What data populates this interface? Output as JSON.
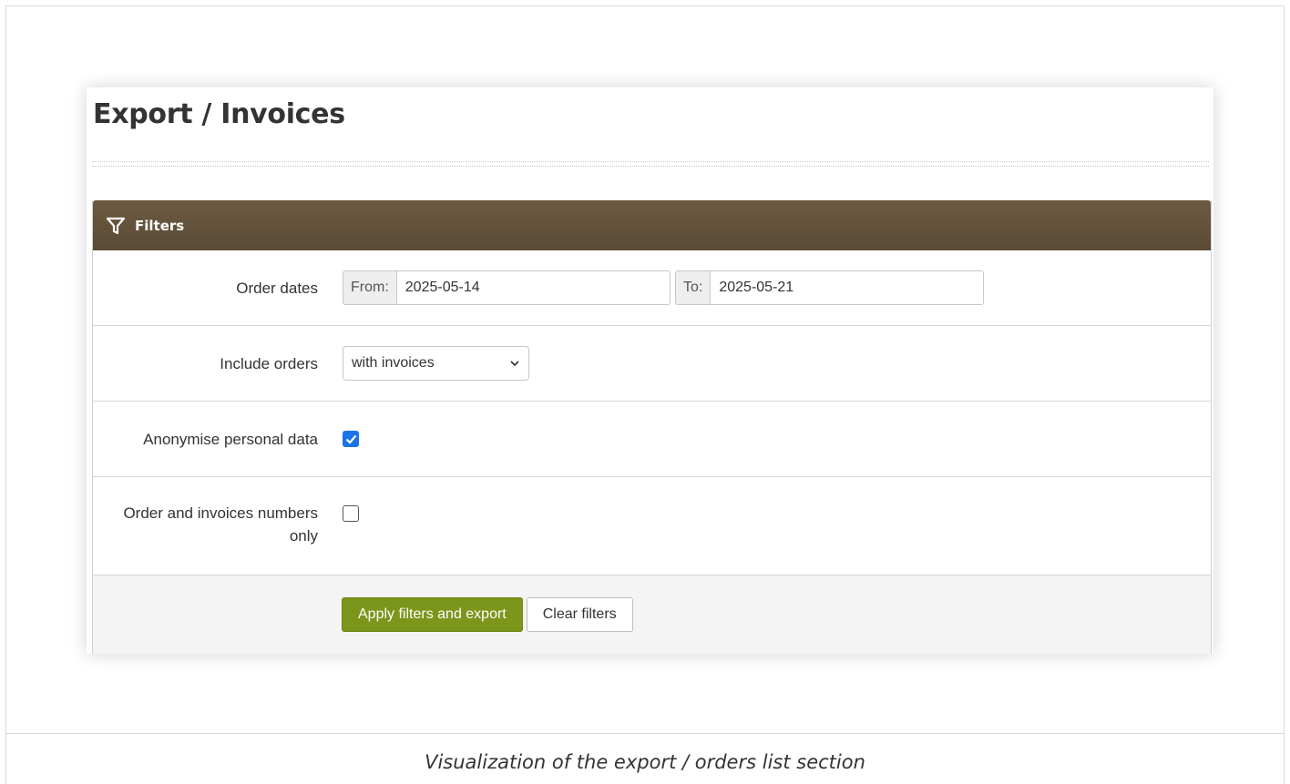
{
  "page": {
    "title": "Export / Invoices",
    "caption": "Visualization of the export / orders list section"
  },
  "filters": {
    "header": "Filters",
    "header_icon": "funnel-icon",
    "order_dates": {
      "label": "Order dates",
      "from_label": "From:",
      "from_value": "2025-05-14",
      "to_label": "To:",
      "to_value": "2025-05-21"
    },
    "include_orders": {
      "label": "Include orders",
      "selected": "with invoices"
    },
    "anonymise": {
      "label": "Anonymise personal data",
      "checked": true
    },
    "numbers_only": {
      "label": "Order and invoices numbers only",
      "checked": false
    },
    "buttons": {
      "apply": "Apply filters and export",
      "clear": "Clear filters"
    }
  },
  "colors": {
    "header_bg": "#5f4e38",
    "primary_button": "#7c951b",
    "checkbox_checked": "#1a73e8"
  }
}
